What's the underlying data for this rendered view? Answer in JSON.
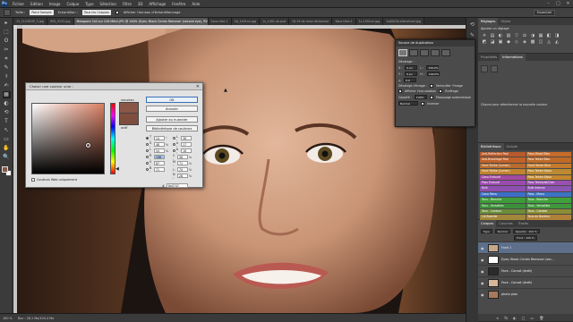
{
  "app": {
    "logo": "Ps",
    "menu": [
      "Fichier",
      "Edition",
      "Image",
      "Calque",
      "Type",
      "Sélection",
      "Filtre",
      "3D",
      "Affichage",
      "Fenêtre",
      "Aide"
    ],
    "window_controls": [
      "–",
      "□",
      "✕"
    ]
  },
  "options": {
    "size_label": "Taille :",
    "size_value": "Point Sample",
    "sample_label": "Echantillon :",
    "sample_value": "Tous les Calques",
    "ring_label": "Afficher l'anneau d'échantillonnage",
    "workspace": "Essentiel"
  },
  "doc_tabs": [
    {
      "label": "15_CLOSEUP_5.jpg"
    },
    {
      "label": "IMG_9155.jpg"
    },
    {
      "label": "Mesopore Cell sur 226 Mitch.JPG @ 100% (Eyes: Black Circles Remover (second eye), RVB/8) *",
      "active": true
    },
    {
      "label": "Sans titre-1"
    },
    {
      "label": "16_1491nn.jpg"
    },
    {
      "label": "1s_1491 ok.psd"
    },
    {
      "label": "18-19 de mise réchanner"
    },
    {
      "label": "Sans titre-2"
    },
    {
      "label": "1s-1491nn.jpg"
    },
    {
      "label": "1s00026-ellenchnel.jpg"
    }
  ],
  "status": {
    "zoom": "100 %",
    "doc": "Doc : 28,1 Mo/104,3 Mo"
  },
  "panels": {
    "adjust_tabs": [
      "Réglages",
      "Styles"
    ],
    "adjust_title": "Ajouter un réglage",
    "adjust_icons": [
      "☀",
      "▤",
      "◐",
      "▧",
      "▽",
      "⚖",
      "◑",
      "▦",
      "◧",
      "◨",
      "◩",
      "◪",
      "▣",
      "◆",
      "◇",
      "◈",
      "▩",
      "◫",
      "◬",
      "◭"
    ],
    "props_tabs": [
      "Propriétés",
      "Informations"
    ],
    "props_hint": "Cliquez pour sélectionner la nouvelle couleur",
    "swatches_tabs": [
      "Bibliothèque",
      "Scripts"
    ],
    "styles_cells": [
      {
        "label": "Anti-Reflection Pool",
        "color": "#b85a2a"
      },
      {
        "label": "Pass Mixed Bleu",
        "color": "#c76b29"
      },
      {
        "label": "Anti-Brouillage Pool",
        "color": "#c16229"
      },
      {
        "label": "Pass Teinte Bleu",
        "color": "#c06a28"
      },
      {
        "label": "Fond Teinte (Lumen)",
        "color": "#b76b2c"
      },
      {
        "label": "Fond Teinte Bleu",
        "color": "#c37a2c"
      },
      {
        "label": "Fond Teinte (Lumen)",
        "color": "#c0832f"
      },
      {
        "label": "Pass Teinte Sépia",
        "color": "#bd8a31"
      },
      {
        "label": "Cano Entouré",
        "color": "#a24aa0"
      },
      {
        "label": "Pass Teinte Sépia",
        "color": "#c3872f"
      },
      {
        "label": "Pass Entouré",
        "color": "#9b4bb0"
      },
      {
        "label": "Pass Teinte/dil/Clair",
        "color": "#9a50b1"
      },
      {
        "label": "Bulk",
        "color": "#8e4fb0"
      },
      {
        "label": "Bulk Intense",
        "color": "#8b54b2"
      },
      {
        "label": "Cano Menu",
        "color": "#3c6ec4"
      },
      {
        "label": "Pass - Menu",
        "color": "#3c73c4"
      },
      {
        "label": "Tous - Blanche",
        "color": "#3f9a3a"
      },
      {
        "label": "Tous - Blanche",
        "color": "#40a03a"
      },
      {
        "label": "Tous - Versailles",
        "color": "#3b8f3a"
      },
      {
        "label": "Tous - Versailles",
        "color": "#41973b"
      },
      {
        "label": "Tous - Contour",
        "color": "#6b8d3a"
      },
      {
        "label": "Tous - Cambie",
        "color": "#8b8e36"
      },
      {
        "label": "Lib Boarder",
        "color": "#a2873a"
      },
      {
        "label": "Tous de Bordeur",
        "color": "#b0813a"
      },
      {
        "label": "Tous Boarder",
        "color": "#b66e3a"
      },
      {
        "label": "Lames Bleue",
        "color": "#b94a38"
      },
      {
        "label": "Lames Glace",
        "color": "#b13b3b"
      },
      {
        "label": "Lames Rouge",
        "color": "#b3393c"
      },
      {
        "label": "Lames Marine",
        "color": "#b0383d"
      },
      {
        "label": "Lames Menu",
        "color": "#a83a45"
      }
    ],
    "layers_tabs": [
      "Calques",
      "Couches",
      "Tracés"
    ],
    "layers_kind": "Type",
    "layers_blend": "Normal",
    "layers_opacity": "Opacité : 100 %",
    "layers_fill": "Fond : 100 %",
    "layers": [
      {
        "name": "Fond 1",
        "thumb": "#c6a78a",
        "selected": true
      },
      {
        "name": "Eyes: Black Circles Remover (sec...",
        "thumb": "#ffffff",
        "selected": false
      },
      {
        "name": "Face - Carnat (draft)",
        "thumb": "#2b2b2b",
        "selected": false
      },
      {
        "name": "Face - Carnat (draft)",
        "thumb": "#d8b69a",
        "selected": false
      },
      {
        "name": "photo plan",
        "thumb": "#a8795c",
        "selected": false
      }
    ],
    "layer_footer_icons": [
      "∞",
      "fx",
      "◐",
      "▢",
      "▭",
      "🗑"
    ]
  },
  "clone_panel": {
    "title": "Source de duplication",
    "offset_label": "Décalage :",
    "x_label": "X :",
    "x_value": "0 px",
    "y_label": "Y :",
    "y_value": "0 px",
    "w_label": "L :",
    "w_value": "100,0%",
    "h_label": "H :",
    "h_value": "100,0%",
    "angle_value": "0,0",
    "frame_offset_label": "Décalage d'image :",
    "frame_lock_label": "Verrouiller l'image",
    "show_overlay": "Afficher l'incrustation",
    "opacity_label": "Opacité :",
    "opacity_value": "100%",
    "normal_value": "Normal",
    "clipped": "Écrêtage",
    "auto_hide": "Masquage automatique",
    "invert": "Inverser"
  },
  "picker": {
    "title": "Choisir une couleur unie :",
    "close": "✕",
    "new_label": "nouveau",
    "current_label": "actif",
    "ok": "OK",
    "cancel": "Annuler",
    "add_swatch": "Ajouter au nuancier",
    "libraries": "Bibliothèque de couleurs",
    "web_only": "Couleurs Web uniquement",
    "new_color": "#8a5747",
    "current_color": "#7f4d3e",
    "fields": [
      {
        "l1": "T :",
        "v1": "14",
        "u1": "°",
        "l2": "L :",
        "v2": "36",
        "on1": true,
        "on2": false
      },
      {
        "l1": "S :",
        "v1": "48",
        "u1": "%",
        "l2": "a :",
        "v2": "17",
        "on1": false,
        "on2": false
      },
      {
        "l1": "L :",
        "v1": "54",
        "u1": "%",
        "l2": "b :",
        "v2": "16",
        "on1": false,
        "on2": false
      },
      {
        "l1": "R :",
        "v1": "138",
        "u1": "",
        "l2": "C :",
        "v2": "38",
        "u2": "%",
        "on1": false,
        "on2": false
      },
      {
        "l1": "V :",
        "v1": "87",
        "u1": "",
        "l2": "M :",
        "v2": "71",
        "u2": "%",
        "on1": false,
        "on2": false
      },
      {
        "l1": "B :",
        "v1": "71",
        "u1": "",
        "l2": "J :",
        "v2": "70",
        "u2": "%",
        "on1": false,
        "on2": false
      },
      {
        "l1": "",
        "v1": "",
        "u1": "",
        "l2": "N :",
        "v2": "28",
        "u2": "%",
        "on1": false,
        "on2": false
      }
    ],
    "hex_label": "#",
    "hex_value": "8a5747"
  },
  "tools": [
    "▸",
    "⬚",
    "ʘ",
    "✂",
    "⌗",
    "✎",
    "⚕",
    "✍",
    "▦",
    "◐",
    "⟲",
    "T",
    "↖",
    "▭",
    "✋",
    "🔍"
  ]
}
